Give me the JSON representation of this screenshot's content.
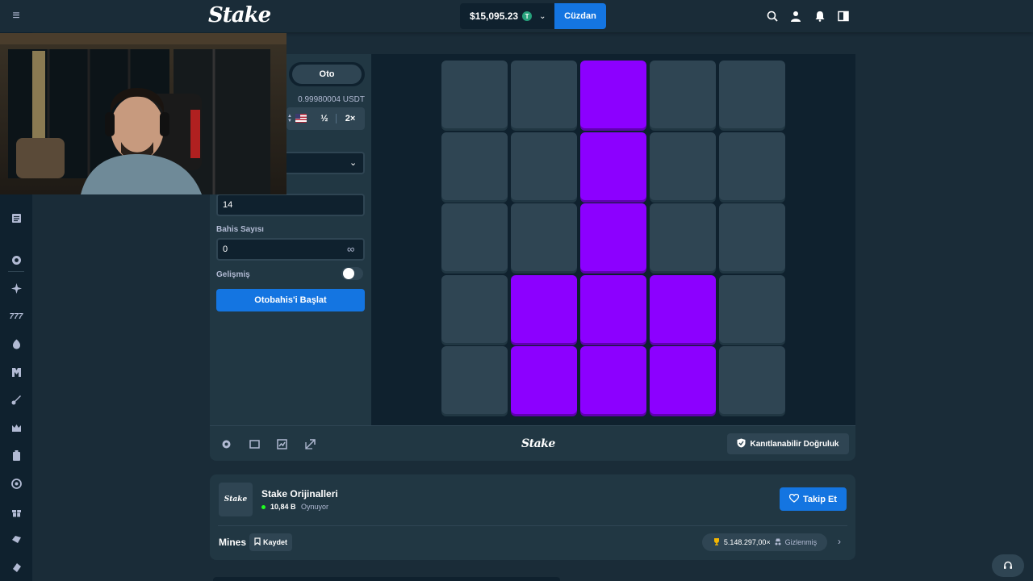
{
  "header": {
    "logo": "Stake",
    "balance": "$15,095.23",
    "currency_icon": "T",
    "wallet_label": "Cüzdan"
  },
  "controls": {
    "tab_auto": "Oto",
    "bet_amount_usdt": "0.99980004 USDT",
    "half_label": "½",
    "double_label": "2×",
    "gems_value": "14",
    "bet_count_label": "Bahis Sayısı",
    "bet_count_value": "0",
    "advanced_label": "Gelişmiş",
    "start_label": "Otobahis'i Başlat"
  },
  "board": {
    "rows": 5,
    "cols": 5,
    "gem_cells": [
      [
        0,
        2
      ],
      [
        1,
        2
      ],
      [
        2,
        2
      ],
      [
        3,
        1
      ],
      [
        3,
        2
      ],
      [
        3,
        3
      ],
      [
        4,
        1
      ],
      [
        4,
        2
      ],
      [
        4,
        3
      ]
    ],
    "gem_color": "#8c00ff",
    "tile_color": "#2f4553"
  },
  "footer": {
    "logo": "Stake",
    "fair_label": "Kanıtlanabilir Doğruluk"
  },
  "info": {
    "thumb_label": "Stake",
    "provider": "Stake Orijinalleri",
    "players_count": "10,84 B",
    "players_label": "Oynuyor",
    "follow_label": "Takip Et",
    "game_name": "Mines",
    "save_label": "Kaydet",
    "record_value": "5.148.297,00×",
    "record_hidden": "Gizlenmiş"
  },
  "colors": {
    "accent": "#1475e1",
    "background": "#1a2c38",
    "panel": "#213743",
    "dark": "#0f212e"
  }
}
